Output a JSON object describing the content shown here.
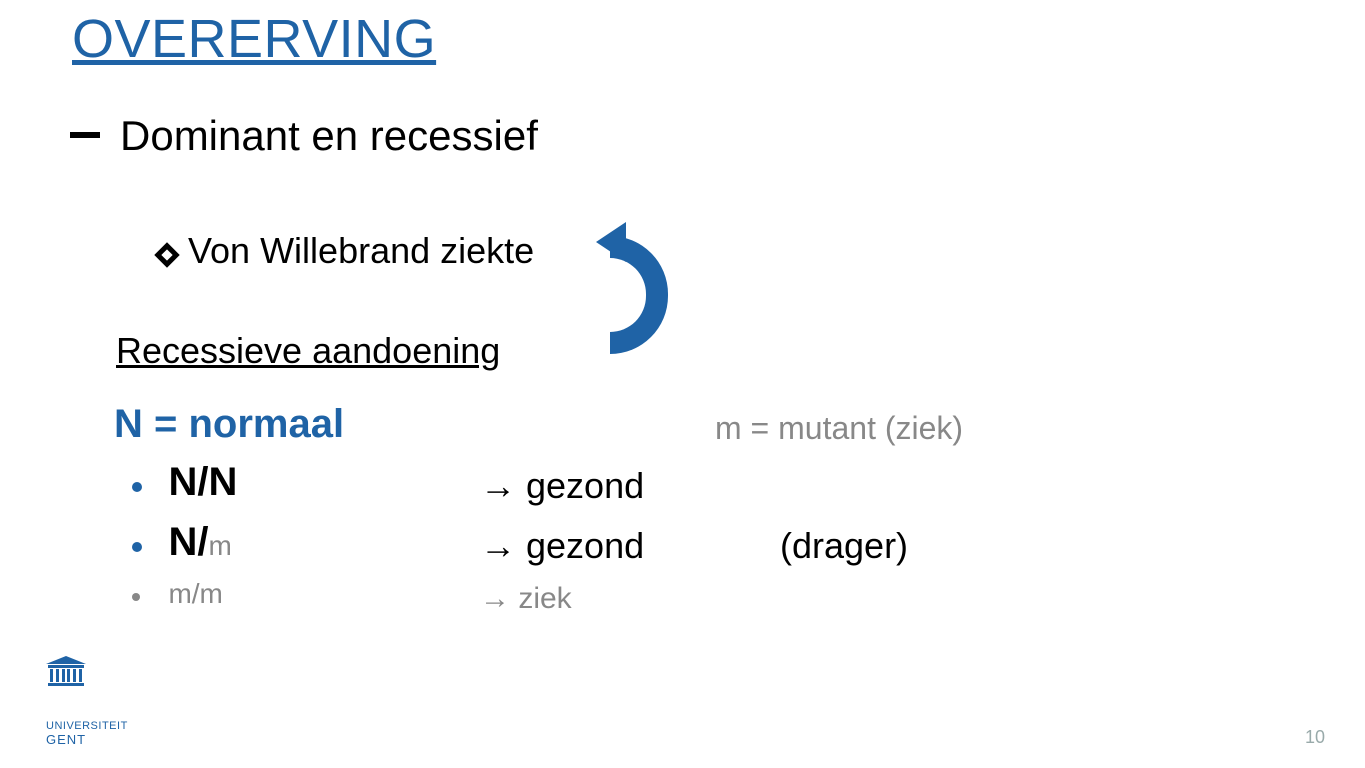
{
  "title": "OVERERVING",
  "subhead": "Dominant en recessief",
  "von_willebrand": "Von Willebrand ziekte",
  "recessive_heading": "Recessieve aandoening",
  "legend": {
    "normal": "N = normaal",
    "mutant": "m = mutant (ziek)"
  },
  "rows": [
    {
      "genotype_main": "N/N",
      "genotype_sub": "",
      "result": "→ gezond",
      "note": ""
    },
    {
      "genotype_main": "N/",
      "genotype_sub": "m",
      "result": "→ gezond",
      "note": "(drager)"
    },
    {
      "genotype_main": "m/m",
      "genotype_sub": "",
      "result": "→ ziek",
      "note": ""
    }
  ],
  "logo": {
    "line1": "UNIVERSITEIT",
    "line2": "GENT"
  },
  "page_number": "10"
}
